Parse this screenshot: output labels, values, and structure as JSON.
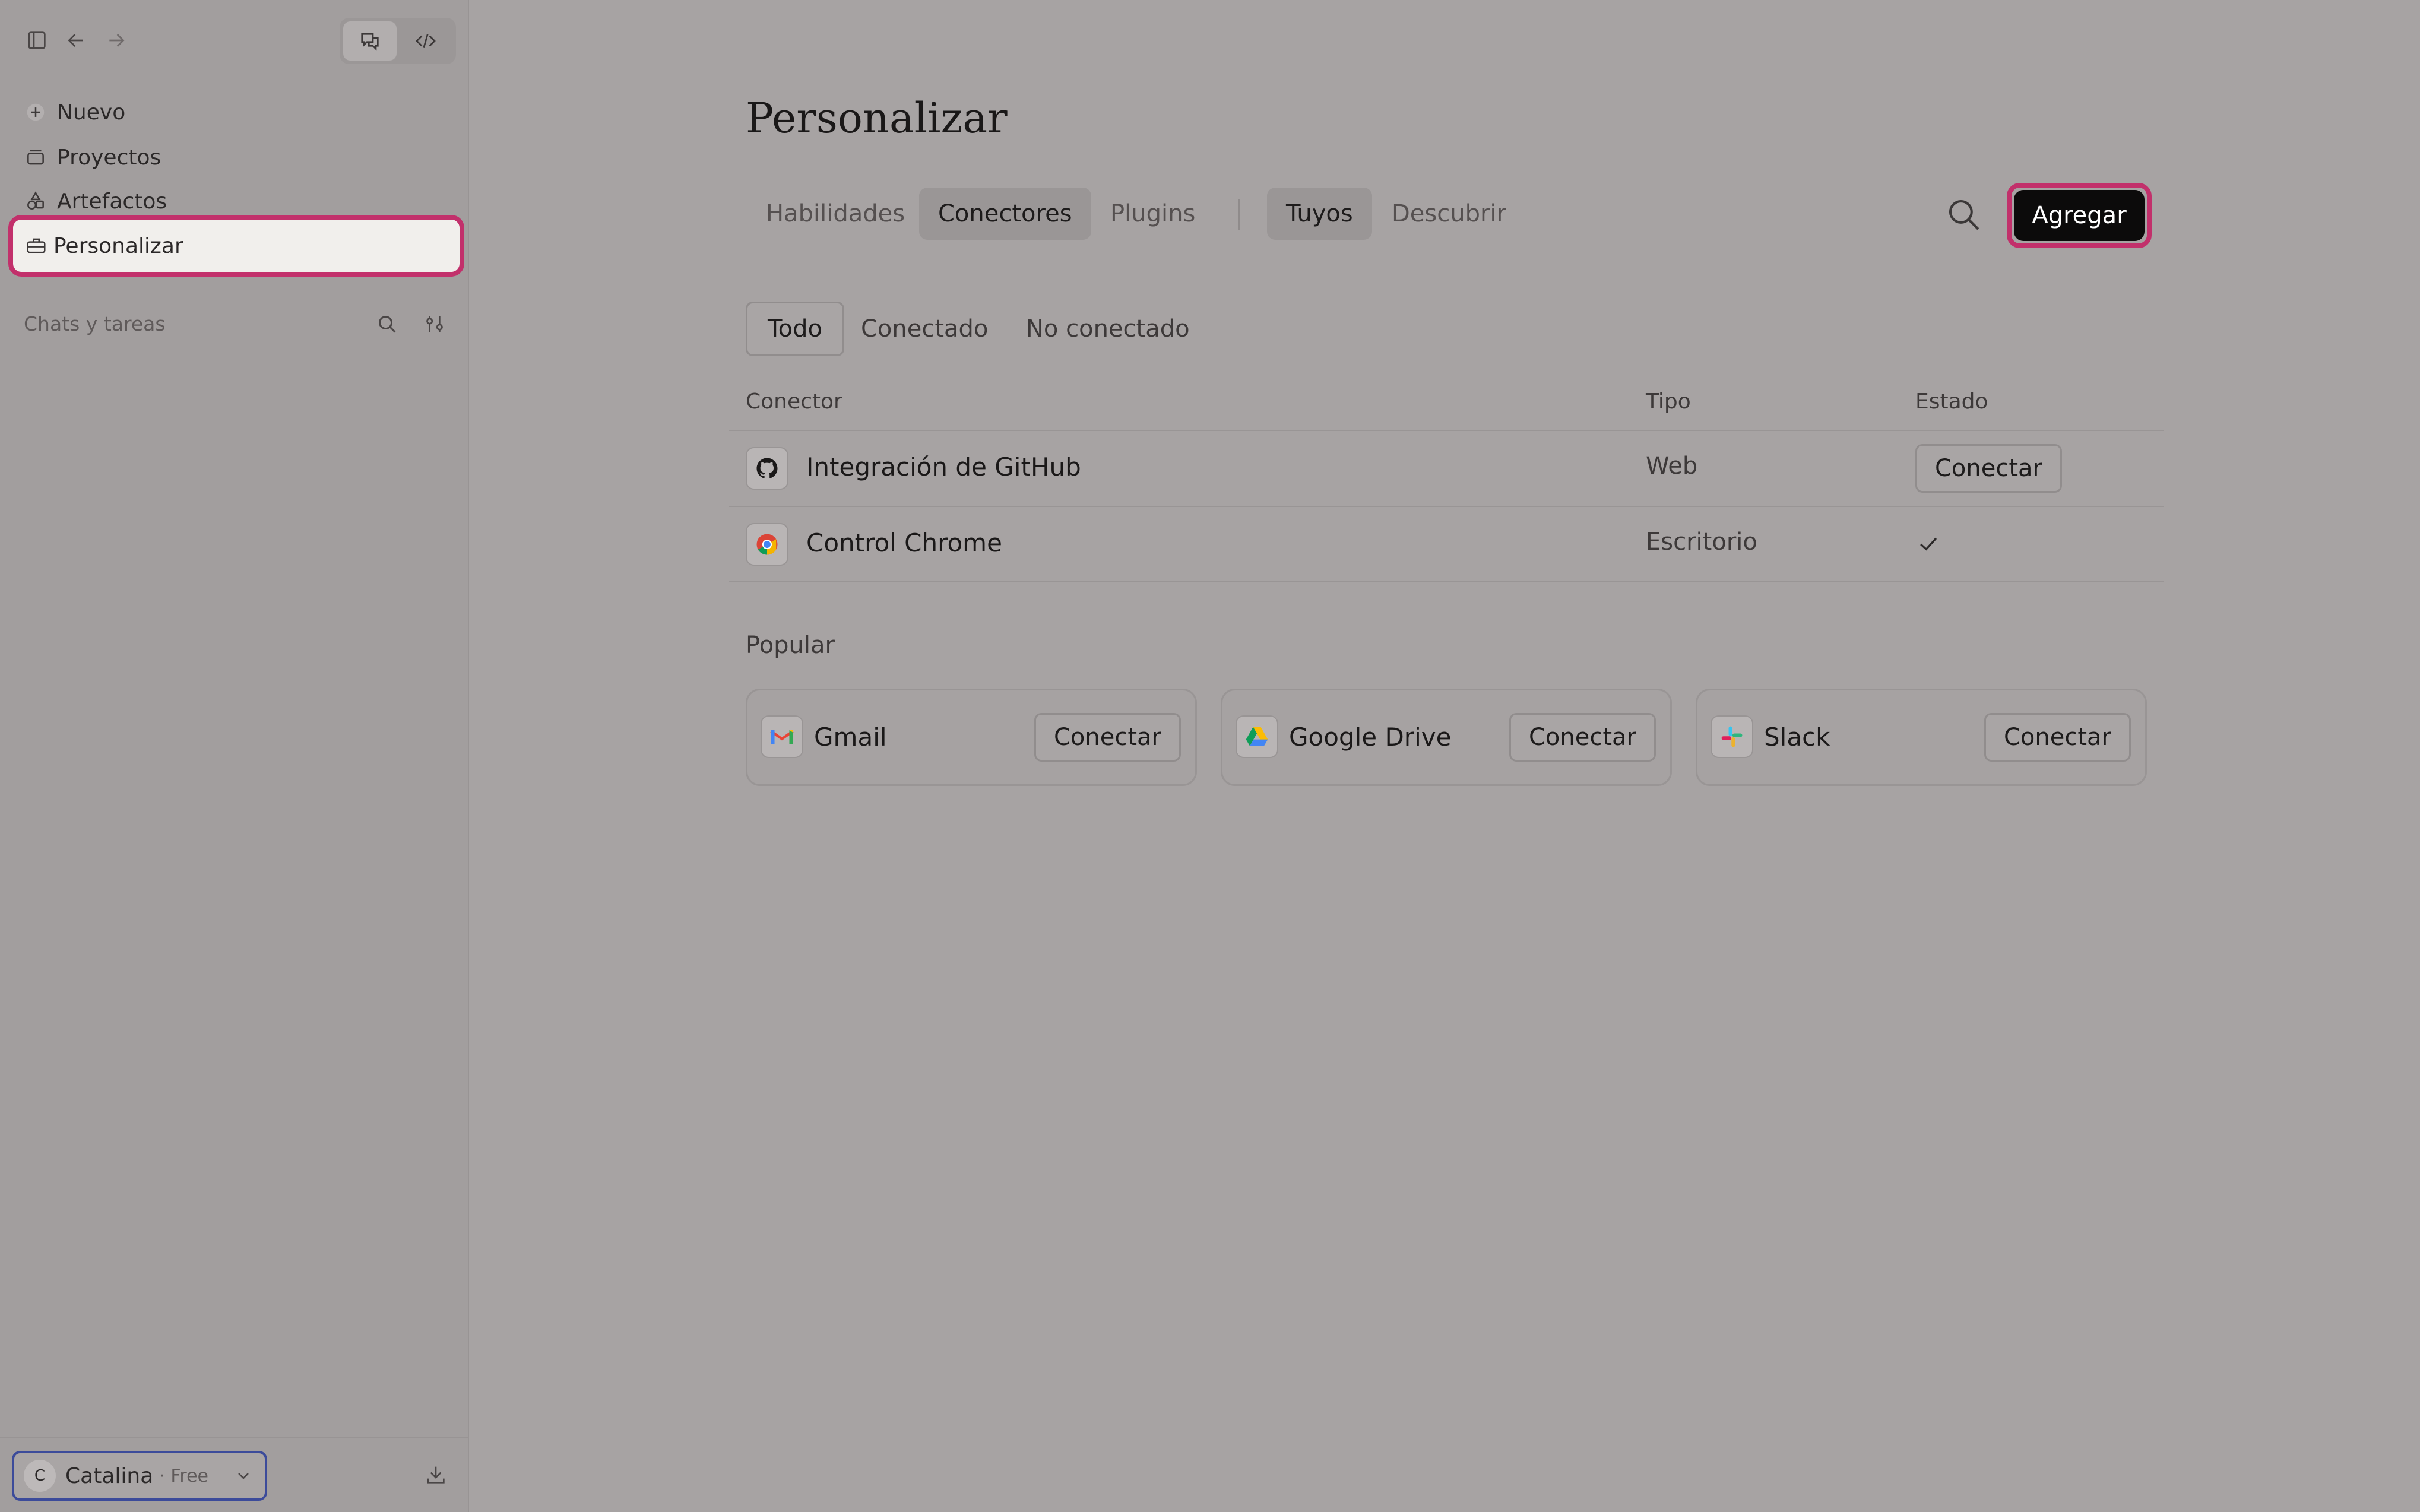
{
  "sidebar": {
    "items": [
      {
        "label": "Nuevo",
        "icon": "plus-icon"
      },
      {
        "label": "Proyectos",
        "icon": "folder-icon"
      },
      {
        "label": "Artefactos",
        "icon": "shapes-icon"
      },
      {
        "label": "Personalizar",
        "icon": "briefcase-icon",
        "active": true
      }
    ],
    "section_label": "Chats y tareas",
    "user": {
      "initial": "C",
      "name": "Catalina",
      "plan": "· Free"
    }
  },
  "main": {
    "title": "Personalizar",
    "tabs": [
      {
        "label": "Habilidades",
        "active": false
      },
      {
        "label": "Conectores",
        "active": true
      },
      {
        "label": "Plugins",
        "active": false
      }
    ],
    "scope_tabs": [
      {
        "label": "Tuyos",
        "active": true
      },
      {
        "label": "Descubrir",
        "active": false
      }
    ],
    "add_label": "Agregar",
    "filters": [
      {
        "label": "Todo",
        "active": true
      },
      {
        "label": "Conectado",
        "active": false
      },
      {
        "label": "No conectado",
        "active": false
      }
    ],
    "table": {
      "headers": [
        "Conector",
        "Tipo",
        "Estado"
      ],
      "rows": [
        {
          "name": "Integración de GitHub",
          "type": "Web",
          "status": "Conectar",
          "icon": "github-icon"
        },
        {
          "name": "Control Chrome",
          "type": "Escritorio",
          "status": "connected",
          "icon": "chrome-icon"
        }
      ]
    },
    "popular": {
      "label": "Popular",
      "cards": [
        {
          "name": "Gmail",
          "action": "Conectar",
          "icon": "gmail-icon"
        },
        {
          "name": "Google Drive",
          "action": "Conectar",
          "icon": "google-drive-icon"
        },
        {
          "name": "Slack",
          "action": "Conectar",
          "icon": "slack-icon"
        }
      ]
    }
  },
  "colors": {
    "highlight": "#c2306b",
    "primary_button": "#0c0b0b",
    "background": "#a7a3a3"
  }
}
